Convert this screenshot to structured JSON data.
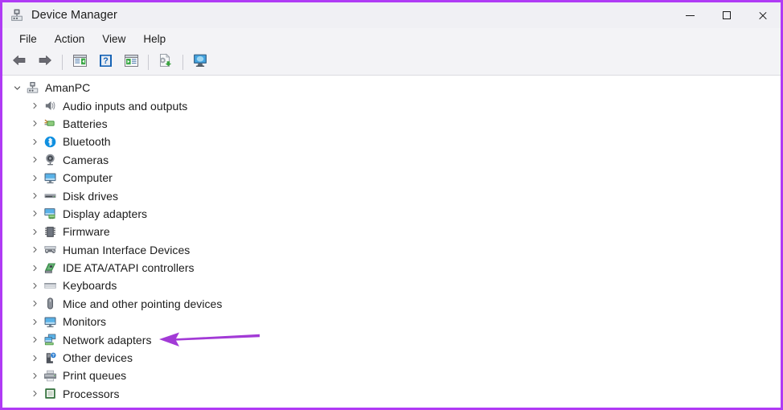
{
  "window": {
    "title": "Device Manager",
    "app_icon": "device-manager-icon",
    "border_color": "#b03bf5",
    "controls": {
      "minimize": "Minimize",
      "maximize": "Maximize",
      "close": "Close"
    }
  },
  "menubar": {
    "items": [
      {
        "label": "File",
        "name": "menu-file"
      },
      {
        "label": "Action",
        "name": "menu-action"
      },
      {
        "label": "View",
        "name": "menu-view"
      },
      {
        "label": "Help",
        "name": "menu-help"
      }
    ]
  },
  "toolbar": {
    "buttons": [
      {
        "icon": "back-arrow-icon",
        "title": "Back"
      },
      {
        "icon": "forward-arrow-icon",
        "title": "Forward"
      },
      {
        "icon": "show-hide-console-tree-icon",
        "title": "Show/Hide Console Tree"
      },
      {
        "icon": "help-icon",
        "title": "Help"
      },
      {
        "icon": "properties-icon",
        "title": "Properties"
      },
      {
        "icon": "update-driver-icon",
        "title": "Update Driver Software"
      },
      {
        "icon": "scan-hardware-changes-icon",
        "title": "Scan for hardware changes"
      }
    ]
  },
  "tree": {
    "root": {
      "label": "AmanPC",
      "icon": "computer-root-icon",
      "expanded": true
    },
    "items": [
      {
        "label": "Audio inputs and outputs",
        "icon": "speaker-icon"
      },
      {
        "label": "Batteries",
        "icon": "battery-icon"
      },
      {
        "label": "Bluetooth",
        "icon": "bluetooth-icon"
      },
      {
        "label": "Cameras",
        "icon": "camera-icon"
      },
      {
        "label": "Computer",
        "icon": "monitor-icon"
      },
      {
        "label": "Disk drives",
        "icon": "disk-drive-icon"
      },
      {
        "label": "Display adapters",
        "icon": "display-adapter-icon"
      },
      {
        "label": "Firmware",
        "icon": "firmware-chip-icon"
      },
      {
        "label": "Human Interface Devices",
        "icon": "hid-icon"
      },
      {
        "label": "IDE ATA/ATAPI controllers",
        "icon": "ide-controller-icon"
      },
      {
        "label": "Keyboards",
        "icon": "keyboard-icon"
      },
      {
        "label": "Mice and other pointing devices",
        "icon": "mouse-icon"
      },
      {
        "label": "Monitors",
        "icon": "monitor-icon"
      },
      {
        "label": "Network adapters",
        "icon": "network-adapter-icon"
      },
      {
        "label": "Other devices",
        "icon": "other-device-icon"
      },
      {
        "label": "Print queues",
        "icon": "printer-icon"
      },
      {
        "label": "Processors",
        "icon": "processor-icon"
      }
    ]
  },
  "annotation": {
    "arrow": {
      "name": "highlight-arrow",
      "color": "#a23ad6",
      "points_to": "Network adapters"
    }
  }
}
